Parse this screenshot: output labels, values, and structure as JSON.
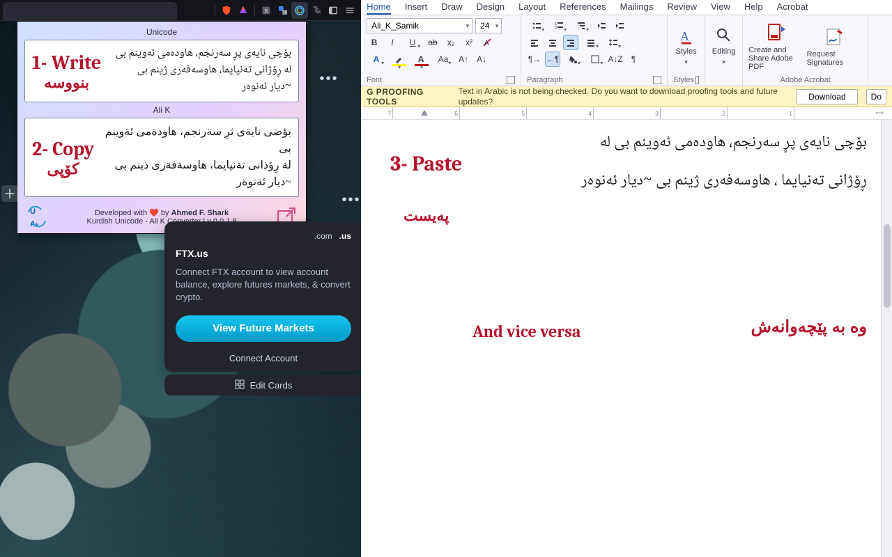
{
  "browser": {
    "icons": {
      "brave": "brave",
      "rewards": "rewards",
      "reader": "R",
      "translate": "G",
      "ext_conv": "conv",
      "puzzle": "ext",
      "paging": "page",
      "menu": "≡"
    }
  },
  "extension": {
    "brand_line1": "Kurdish Unicode - Ali K Converter | ",
    "version": "v 0.0.1.8",
    "credit_prefix": "Developed with ",
    "credit_by": " by ",
    "credit_name": "Ahmed F. Shark",
    "unicode_label": "Unicode",
    "alik_label": "Ali K",
    "step1_en": "1- Write",
    "step1_ku": "بنووسه",
    "step2_en": "2- Copy",
    "step2_ku": "کۆپی",
    "sample_unicode": "بۆچی نایەی پڕ سەرنجم، هاودەمی ئەوینم بی\nلە ڕۆژانی تەنیایما، هاوسەفەری ژینم بی\n~دیار ئەنوەر",
    "sample_alik": "بؤضى نايةى ثرِ سةرنجم، هاودةمى ئةوينم بى\nلة رِؤذانى تةنيايما، هاوسةفةرى ذينم بى\n~ديار ئةنوةر"
  },
  "ftx": {
    "title": "FTX.us",
    "desc": "Connect FTX account to view account balance, explore futures markets, & convert crypto.",
    "tld_com": ".com",
    "tld_us": ".us",
    "primary": "View Future Markets",
    "secondary": "Connect Account",
    "edit_cards": "Edit Cards",
    "add_site": "add site"
  },
  "word": {
    "tabs": [
      "Home",
      "Insert",
      "Draw",
      "Design",
      "Layout",
      "References",
      "Mailings",
      "Review",
      "View",
      "Help",
      "Acrobat"
    ],
    "active_tab": "Home",
    "font_name": "Ali_K_Samik",
    "font_size": "24",
    "groups": {
      "font": "Font",
      "paragraph": "Paragraph",
      "styles": "Styles",
      "editing": "Editing",
      "acrobat": "Adobe Acrobat"
    },
    "acrobat": {
      "create": "Create and Share Adobe PDF",
      "sign": "Request Signatures"
    },
    "proof": {
      "title": "G PROOFING TOOLS",
      "msg": "Text in Arabic is not being checked. Do you want to download proofing tools and future updates?",
      "download": "Download",
      "do": "Do"
    },
    "ruler_numbers": [
      "7",
      "6",
      "5",
      "4",
      "3",
      "2",
      "1"
    ],
    "step3_en": "3- Paste",
    "step3_ku": "پەیست",
    "doc_body": "بۆچی نایەی پڕ سەرنجم، هاودەمی ئەوینم بی\nلە ڕۆژانی تەنیایما ، هاوسەفەری ژینم بی\n~دیار ئەنوەر",
    "vice_en": "And vice versa",
    "vice_ku": "وە بە پێچەوانەش"
  }
}
